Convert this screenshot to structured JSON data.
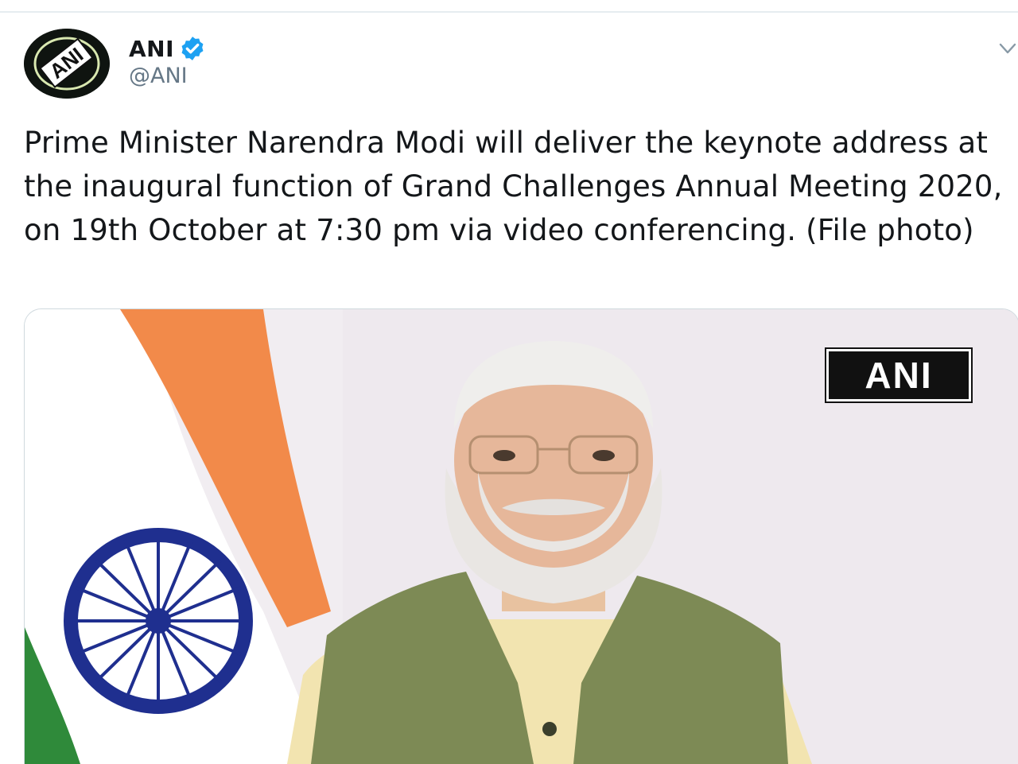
{
  "tweet": {
    "author": {
      "name": "ANI",
      "handle": "@ANI",
      "verified": true,
      "avatar_label": "ANI"
    },
    "text": "Prime Minister Narendra Modi will deliver the keynote address at the inaugural function of Grand Challenges Annual Meeting 2020, on 19th October at 7:30 pm via video conferencing. (File photo)",
    "media": {
      "watermark": "ANI"
    }
  },
  "colors": {
    "verified": "#1da1f2",
    "handle": "#657786",
    "text": "#14171a",
    "flag_saffron": "#f28a4a",
    "flag_green": "#2f8a3a",
    "chakra": "#1f2f8f"
  },
  "icons": {
    "verified": "verified-badge-icon",
    "menu": "chevron-down-icon"
  }
}
